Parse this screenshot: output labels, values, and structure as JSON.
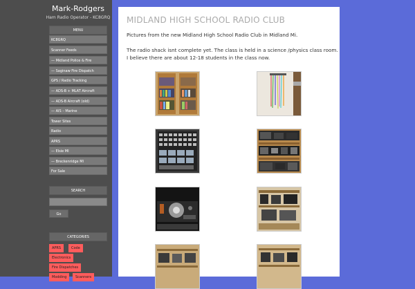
{
  "site": {
    "title": "Mark-Rodgers",
    "tagline": "Ham Radio Operator - KC8GRQ"
  },
  "sidebar": {
    "menu_title": "MENU",
    "menu_items": [
      "KC8GRQ",
      "Scanner Feeds",
      "— Midland Police & Fire",
      "— Saginaw Fire Dispatch",
      "GPS / Radio Tracking",
      "— ADS-B + MLAT Aircraft",
      "— ADS-B Aircraft (old)",
      "— AIS – Marine",
      "Tower Sites",
      "Radio",
      "APRS",
      "— Elsie MI",
      "— Breckenridge MI",
      "For Sale"
    ],
    "search_title": "SEARCH",
    "search_button": "Go",
    "categories_title": "CATEGORIES",
    "tags": [
      "APRS",
      "Code",
      "Electronics",
      "Fire Dispatches",
      "Modding",
      "Scanners"
    ]
  },
  "main": {
    "title": "MIDLAND HIGH SCHOOL RADIO CLUB",
    "para1": "Pictures from the new Midland High School Radio Club in Midland Mi.",
    "para2_line1": "The radio shack isnt complete yet. The class is held in a science /physics class room.",
    "para2_line2": "I believe there are about 12-18 students in the class now."
  }
}
